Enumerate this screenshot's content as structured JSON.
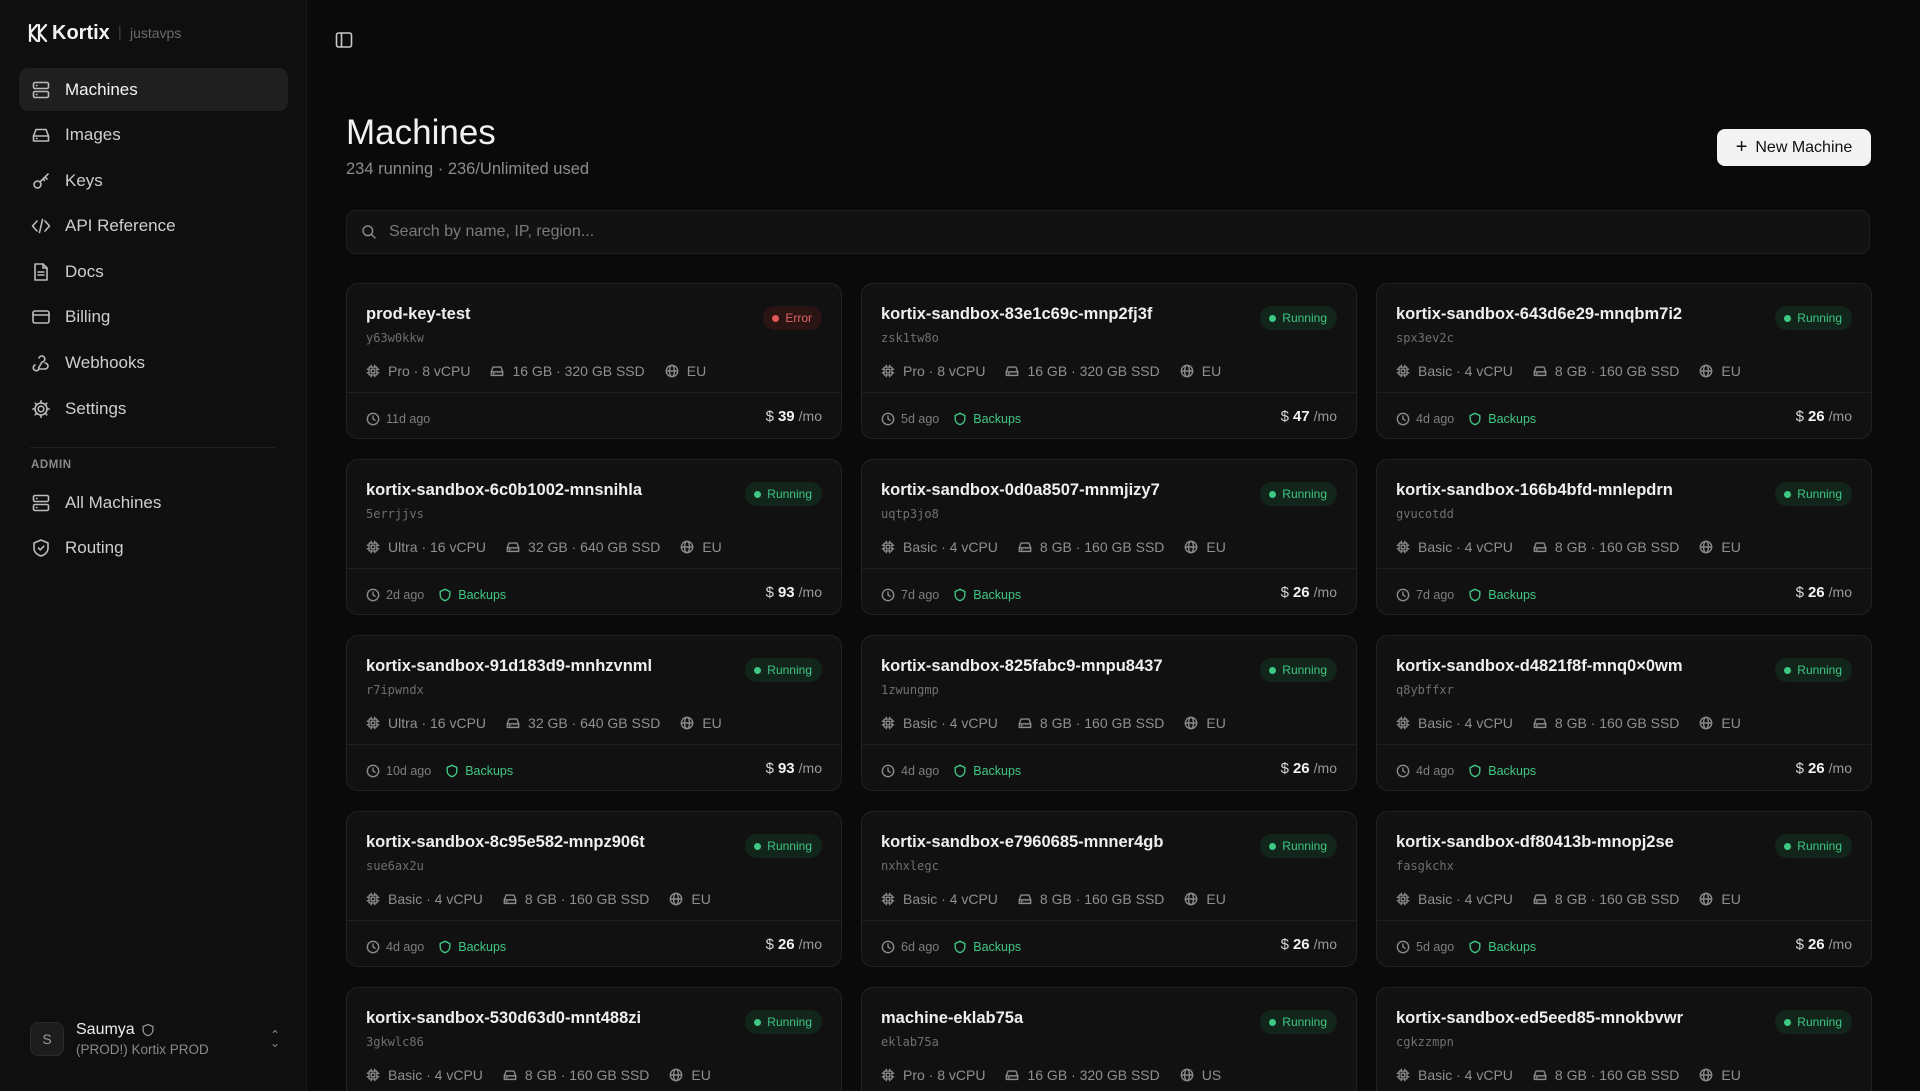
{
  "brand": {
    "name": "Kortix",
    "org": "justavps"
  },
  "nav": [
    {
      "label": "Machines",
      "icon": "server-icon",
      "active": true
    },
    {
      "label": "Images",
      "icon": "hard-drive-icon",
      "active": false
    },
    {
      "label": "Keys",
      "icon": "key-icon",
      "active": false
    },
    {
      "label": "API Reference",
      "icon": "code-icon",
      "active": false
    },
    {
      "label": "Docs",
      "icon": "document-icon",
      "active": false
    },
    {
      "label": "Billing",
      "icon": "credit-card-icon",
      "active": false
    },
    {
      "label": "Webhooks",
      "icon": "webhook-icon",
      "active": false
    },
    {
      "label": "Settings",
      "icon": "gear-icon",
      "active": false
    }
  ],
  "admin": {
    "section_label": "ADMIN",
    "items": [
      {
        "label": "All Machines",
        "icon": "server-icon"
      },
      {
        "label": "Routing",
        "icon": "shield-icon"
      }
    ]
  },
  "user": {
    "initial": "S",
    "name": "Saumya",
    "org": "(PROD!) Kortix PROD"
  },
  "page": {
    "title": "Machines",
    "subtitle": "234 running · 236/Unlimited used",
    "new_button": "New Machine"
  },
  "search": {
    "placeholder": "Search by name, IP, region..."
  },
  "machines": [
    {
      "name": "prod-key-test",
      "id": "y63w0kkw",
      "status": "Error",
      "plan": "Pro · 8 vCPU",
      "storage": "16 GB · 320 GB SSD",
      "region": "EU",
      "age": "11d ago",
      "backups": "",
      "price": "39",
      "period": "/mo"
    },
    {
      "name": "kortix-sandbox-83e1c69c-mnp2fj3f",
      "id": "zsk1tw8o",
      "status": "Running",
      "plan": "Pro · 8 vCPU",
      "storage": "16 GB · 320 GB SSD",
      "region": "EU",
      "age": "5d ago",
      "backups": "Backups",
      "price": "47",
      "period": "/mo"
    },
    {
      "name": "kortix-sandbox-643d6e29-mnqbm7i2",
      "id": "spx3ev2c",
      "status": "Running",
      "plan": "Basic · 4 vCPU",
      "storage": "8 GB · 160 GB SSD",
      "region": "EU",
      "age": "4d ago",
      "backups": "Backups",
      "price": "26",
      "period": "/mo"
    },
    {
      "name": "kortix-sandbox-6c0b1002-mnsnihla",
      "id": "5errjjvs",
      "status": "Running",
      "plan": "Ultra · 16 vCPU",
      "storage": "32 GB · 640 GB SSD",
      "region": "EU",
      "age": "2d ago",
      "backups": "Backups",
      "price": "93",
      "period": "/mo"
    },
    {
      "name": "kortix-sandbox-0d0a8507-mnmjizy7",
      "id": "uqtp3jo8",
      "status": "Running",
      "plan": "Basic · 4 vCPU",
      "storage": "8 GB · 160 GB SSD",
      "region": "EU",
      "age": "7d ago",
      "backups": "Backups",
      "price": "26",
      "period": "/mo"
    },
    {
      "name": "kortix-sandbox-166b4bfd-mnlepdrn",
      "id": "gvucotdd",
      "status": "Running",
      "plan": "Basic · 4 vCPU",
      "storage": "8 GB · 160 GB SSD",
      "region": "EU",
      "age": "7d ago",
      "backups": "Backups",
      "price": "26",
      "period": "/mo"
    },
    {
      "name": "kortix-sandbox-91d183d9-mnhzvnml",
      "id": "r7ipwndx",
      "status": "Running",
      "plan": "Ultra · 16 vCPU",
      "storage": "32 GB · 640 GB SSD",
      "region": "EU",
      "age": "10d ago",
      "backups": "Backups",
      "price": "93",
      "period": "/mo"
    },
    {
      "name": "kortix-sandbox-825fabc9-mnpu8437",
      "id": "1zwungmp",
      "status": "Running",
      "plan": "Basic · 4 vCPU",
      "storage": "8 GB · 160 GB SSD",
      "region": "EU",
      "age": "4d ago",
      "backups": "Backups",
      "price": "26",
      "period": "/mo"
    },
    {
      "name": "kortix-sandbox-d4821f8f-mnq0×0wm",
      "id": "q8ybffxr",
      "status": "Running",
      "plan": "Basic · 4 vCPU",
      "storage": "8 GB · 160 GB SSD",
      "region": "EU",
      "age": "4d ago",
      "backups": "Backups",
      "price": "26",
      "period": "/mo"
    },
    {
      "name": "kortix-sandbox-8c95e582-mnpz906t",
      "id": "sue6ax2u",
      "status": "Running",
      "plan": "Basic · 4 vCPU",
      "storage": "8 GB · 160 GB SSD",
      "region": "EU",
      "age": "4d ago",
      "backups": "Backups",
      "price": "26",
      "period": "/mo"
    },
    {
      "name": "kortix-sandbox-e7960685-mnner4gb",
      "id": "nxhxlegc",
      "status": "Running",
      "plan": "Basic · 4 vCPU",
      "storage": "8 GB · 160 GB SSD",
      "region": "EU",
      "age": "6d ago",
      "backups": "Backups",
      "price": "26",
      "period": "/mo"
    },
    {
      "name": "kortix-sandbox-df80413b-mnopj2se",
      "id": "fasgkchx",
      "status": "Running",
      "plan": "Basic · 4 vCPU",
      "storage": "8 GB · 160 GB SSD",
      "region": "EU",
      "age": "5d ago",
      "backups": "Backups",
      "price": "26",
      "period": "/mo"
    },
    {
      "name": "kortix-sandbox-530d63d0-mnt488zi",
      "id": "3gkwlc86",
      "status": "Running",
      "plan": "Basic · 4 vCPU",
      "storage": "8 GB · 160 GB SSD",
      "region": "EU",
      "age": "",
      "backups": "",
      "price": "",
      "period": ""
    },
    {
      "name": "machine-eklab75a",
      "id": "eklab75a",
      "status": "Running",
      "plan": "Pro · 8 vCPU",
      "storage": "16 GB · 320 GB SSD",
      "region": "US",
      "age": "",
      "backups": "",
      "price": "",
      "period": ""
    },
    {
      "name": "kortix-sandbox-ed5eed85-mnokbvwr",
      "id": "cgkzzmpn",
      "status": "Running",
      "plan": "Basic · 4 vCPU",
      "storage": "8 GB · 160 GB SSD",
      "region": "EU",
      "age": "",
      "backups": "",
      "price": "",
      "period": ""
    }
  ],
  "colors": {
    "accent_green": "#3fc784",
    "error_red": "#e05555",
    "background": "#0a0a0a",
    "card": "#111111"
  }
}
